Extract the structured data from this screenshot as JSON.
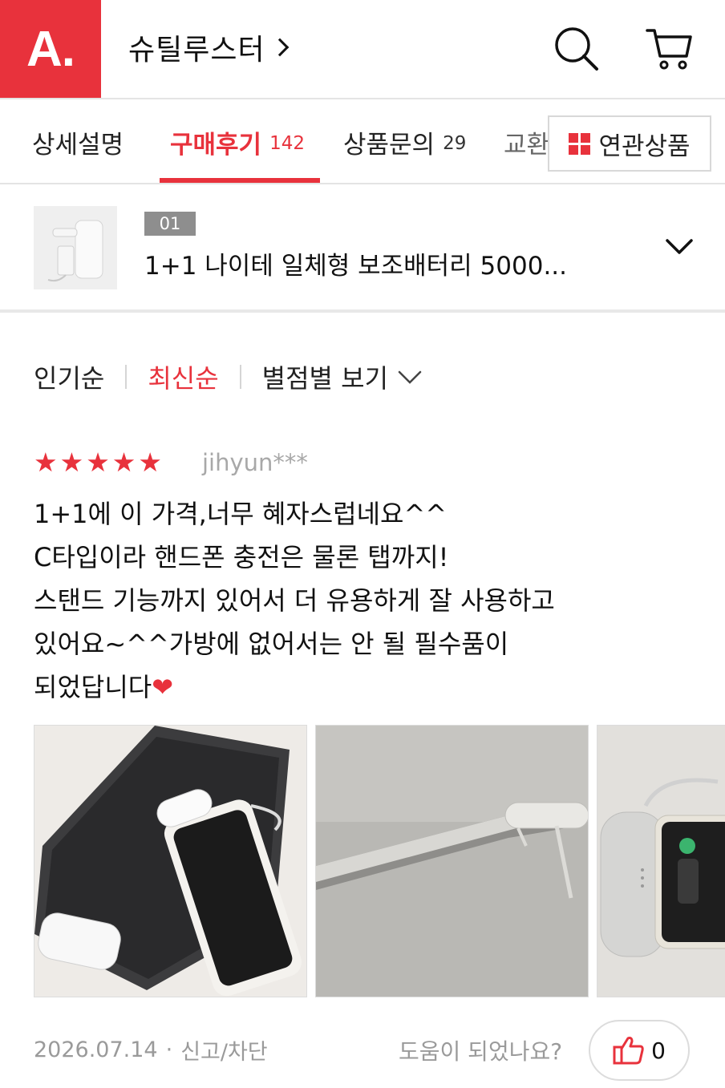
{
  "header": {
    "logo_text": "A.",
    "brand_name": "슈틸루스터",
    "accent_color": "#e8323c",
    "icons": [
      "search-icon",
      "cart-icon"
    ]
  },
  "tabs": {
    "items": [
      {
        "label": "상세설명",
        "count": ""
      },
      {
        "label": "구매후기",
        "count": "142"
      },
      {
        "label": "상품문의",
        "count": "29"
      },
      {
        "label": "교환",
        "count": ""
      }
    ],
    "active": "구매후기",
    "related_label": "연관상품"
  },
  "product": {
    "badge": "01",
    "title": "1+1 나이테 일체형 보조배터리 5000..."
  },
  "sort": {
    "popular": "인기순",
    "latest": "최신순",
    "by_rating": "별점별 보기",
    "active": "최신순"
  },
  "review": {
    "rating": 5,
    "reviewer": "jihyun***",
    "text": "1+1에 이 가격,너무 혜자스럽네요^^\nC타입이라 핸드폰 충전은 물론 탭까지!\n스탠드 기능까지 있어서 더 유용하게 잘 사용하고\n있어요~^^가방에 없어서는 안 될 필수품이\n되었답니다",
    "emoji": "❤",
    "date": "2026.07.14",
    "separator": "·",
    "report_label": "신고/차단",
    "helpful_question": "도움이 되었나요?",
    "like_count": "0"
  }
}
